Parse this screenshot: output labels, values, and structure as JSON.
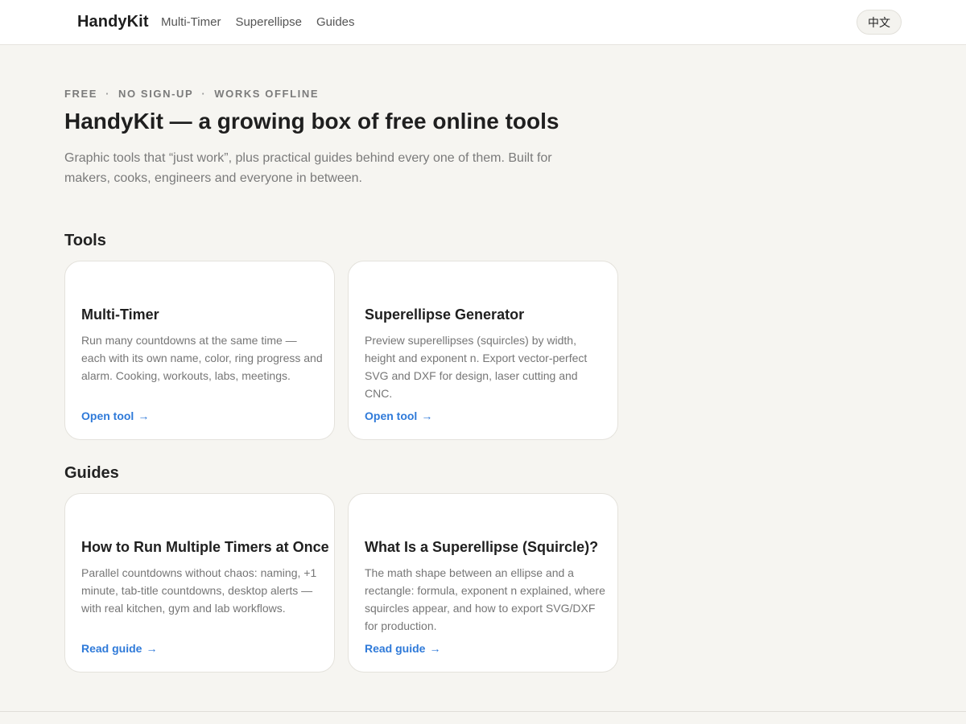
{
  "header": {
    "brand": "HandyKit",
    "nav": [
      "Multi-Timer",
      "Superellipse",
      "Guides"
    ],
    "lang_button": "中文"
  },
  "hero": {
    "eyebrow": [
      "FREE",
      "NO SIGN-UP",
      "WORKS OFFLINE"
    ],
    "eyebrow_sep": "·",
    "title": "HandyKit — a growing box of free online tools",
    "subtitle": "Graphic tools that “just work”, plus practical guides behind every one of them. Built for makers, cooks, engineers and everyone in between."
  },
  "tools": {
    "heading": "Tools",
    "cards": [
      {
        "title": "Multi-Timer",
        "description": "Run many countdowns at the same time — each with its own name, color, ring progress and alarm. Cooking, workouts, labs, meetings.",
        "link": "Open tool"
      },
      {
        "title": "Superellipse Generator",
        "description": "Preview superellipses (squircles) by width, height and exponent n. Export vector-perfect SVG and DXF for design, laser cutting and CNC.",
        "link": "Open tool"
      }
    ]
  },
  "guides": {
    "heading": "Guides",
    "cards": [
      {
        "title": "How to Run Multiple Timers at Once",
        "description": "Parallel countdowns without chaos: naming, +1 minute, tab-title countdowns, desktop alerts — with real kitchen, gym and lab workflows.",
        "link": "Read guide"
      },
      {
        "title": "What Is a Superellipse (Squircle)?",
        "description": "The math shape between an ellipse and a rectangle: formula, exponent n explained, where squircles appear, and how to export SVG/DXF for production.",
        "link": "Read guide"
      }
    ]
  },
  "arrow": "→",
  "colors": {
    "background": "#f6f5f1",
    "accent_link": "#2f7ad9",
    "card_background": "#ffffff"
  }
}
